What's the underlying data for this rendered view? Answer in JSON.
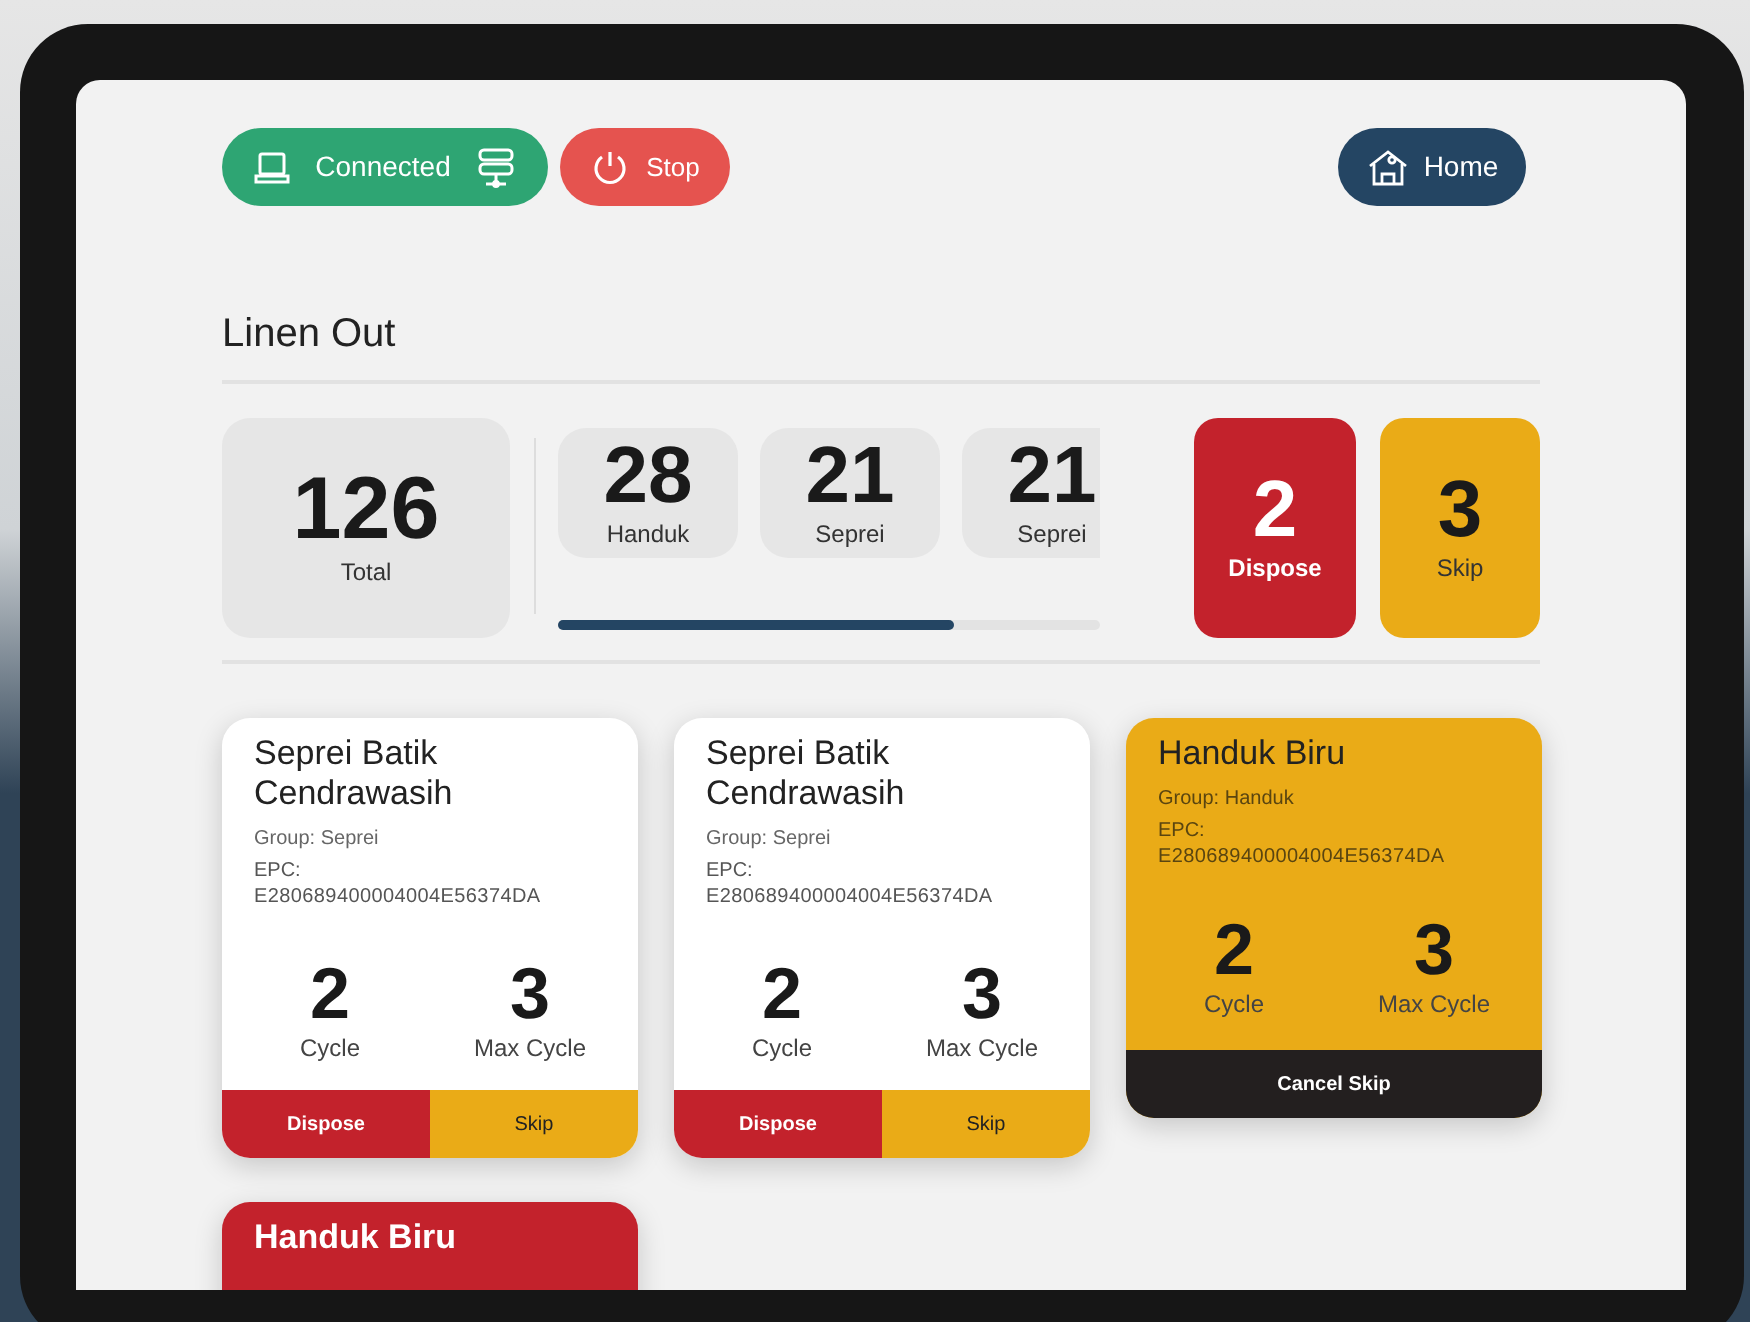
{
  "top_bar": {
    "connection": {
      "label": "Connected"
    },
    "stop": {
      "label": "Stop"
    },
    "home": {
      "label": "Home"
    }
  },
  "title": "Linen Out",
  "total": {
    "value": "126",
    "label": "Total"
  },
  "groups": [
    {
      "value": "28",
      "label": "Handuk"
    },
    {
      "value": "21",
      "label": "Seprei"
    },
    {
      "value": "21",
      "label": "Seprei"
    }
  ],
  "groups_scroll": {
    "level": 0.73
  },
  "dispose": {
    "value": "2",
    "label": "Dispose"
  },
  "skip": {
    "value": "3",
    "label": "Skip"
  },
  "items": [
    {
      "kind": "normal",
      "name": "Seprei Batik Cendrawasih",
      "group": "Group: Seprei",
      "epc_label": "EPC:",
      "epc": "E280689400004004E56374DA",
      "cycle": "2",
      "cycle_label": "Cycle",
      "max_cycle": "3",
      "max_cycle_label": "Max Cycle",
      "actions": [
        "Dispose",
        "Skip"
      ]
    },
    {
      "kind": "normal",
      "name": "Seprei Batik Cendrawasih",
      "group": "Group: Seprei",
      "epc_label": "EPC:",
      "epc": "E280689400004004E56374DA",
      "cycle": "2",
      "cycle_label": "Cycle",
      "max_cycle": "3",
      "max_cycle_label": "Max Cycle",
      "actions": [
        "Dispose",
        "Skip"
      ]
    },
    {
      "kind": "skipped",
      "name": "Handuk Biru",
      "group": "Group: Handuk",
      "epc_label": "EPC:",
      "epc": "E280689400004004E56374DA",
      "cycle": "2",
      "cycle_label": "Cycle",
      "max_cycle": "3",
      "max_cycle_label": "Max Cycle",
      "actions": [
        "Cancel Skip"
      ]
    },
    {
      "kind": "disposed",
      "name": "Handuk Biru"
    }
  ]
}
